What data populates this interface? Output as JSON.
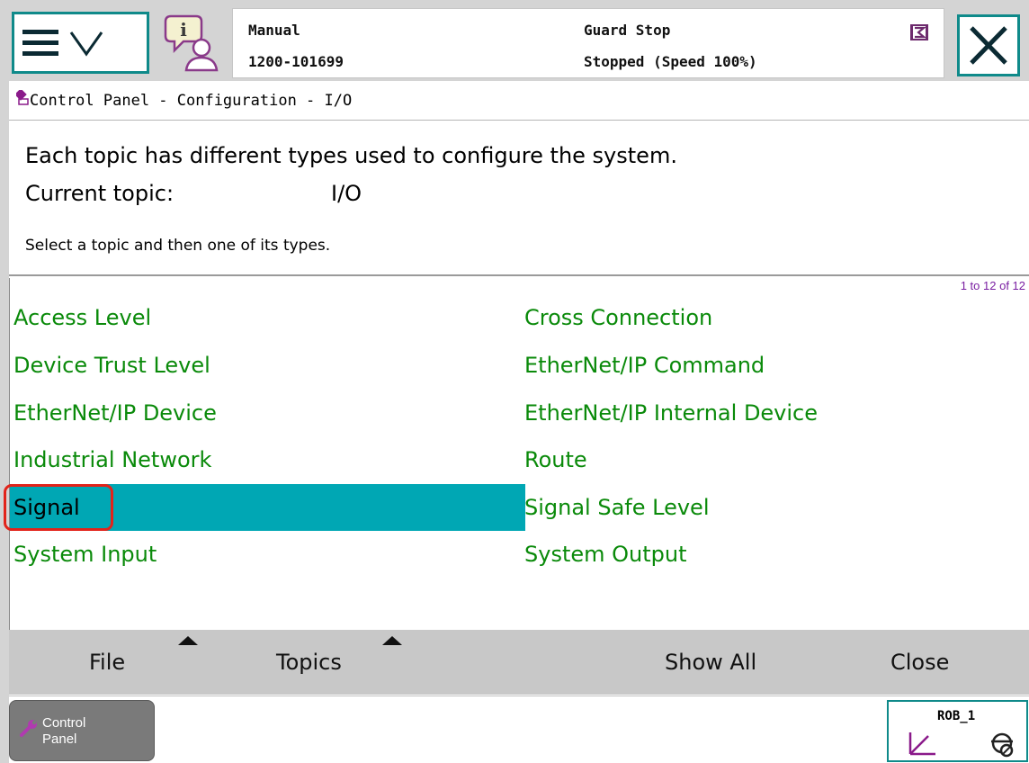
{
  "status": {
    "mode": "Manual",
    "system_id": "1200-101699",
    "state": "Guard Stop",
    "speed": "Stopped (Speed 100%)"
  },
  "breadcrumb": "Control Panel - Configuration - I/O",
  "description": {
    "line": "Each topic has different types used to configure the system.",
    "topic_label": "Current topic:",
    "topic_value": "I/O",
    "instruction": "Select a topic and then one of its types."
  },
  "list": {
    "count": "1 to 12 of 12",
    "left_items": [
      "Access Level",
      "Device Trust Level",
      "EtherNet/IP Device",
      "Industrial Network",
      "Signal",
      "System Input"
    ],
    "right_items": [
      "Cross Connection",
      "EtherNet/IP Command",
      "EtherNet/IP Internal Device",
      "Route",
      "Signal Safe Level",
      "System Output"
    ],
    "selected": "Signal"
  },
  "commands": {
    "file": "File",
    "topics": "Topics",
    "show_all": "Show All",
    "close": "Close"
  },
  "taskbar": {
    "control_panel_line1": "Control",
    "control_panel_line2": "Panel",
    "robot": "ROB_1"
  },
  "icons": {
    "menu": "hamburger-chevron-icon",
    "info": "info-user-icon",
    "status": "status-document-icon",
    "close": "close-x-icon",
    "breadcrumb": "control-panel-icon",
    "control_panel_task": "wrench-icon",
    "robot": "coordinate-axes-icon"
  },
  "colors": {
    "accent": "#0f8a8a",
    "list_text": "#0a8a0a",
    "selection": "#00a7b4",
    "highlight_outline": "#e2231a",
    "count_text": "#7a1fa2"
  }
}
